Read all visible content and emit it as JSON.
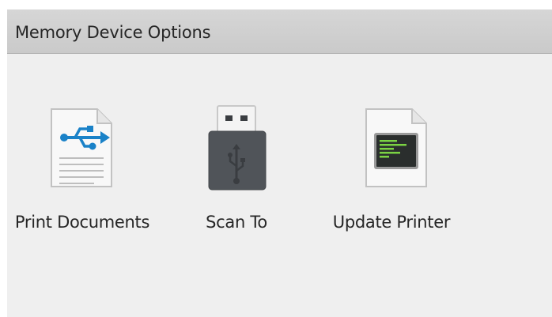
{
  "header": {
    "title": "Memory Device Options"
  },
  "options": [
    {
      "label": "Print Documents",
      "icon": "usb-document-icon"
    },
    {
      "label": "Scan To",
      "icon": "usb-drive-icon"
    },
    {
      "label": "Update Printer",
      "icon": "firmware-document-icon"
    }
  ],
  "colors": {
    "title_bar": "#cfcfcf",
    "background": "#efefef",
    "usb_blue": "#1a82c8",
    "drive_body": "#505459",
    "screen_green": "#7bd243"
  }
}
